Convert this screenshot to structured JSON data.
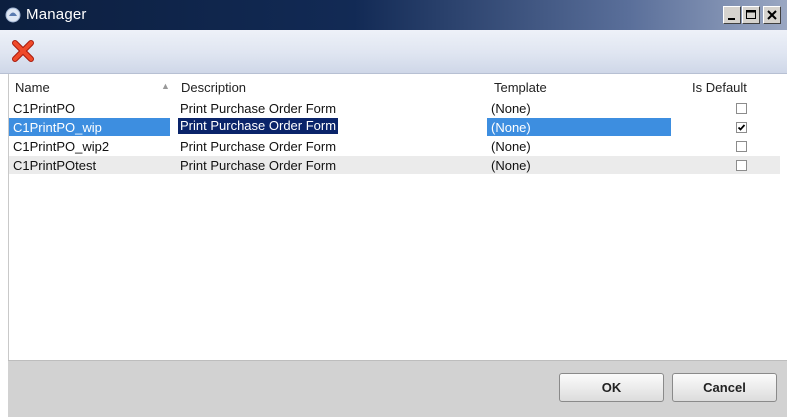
{
  "window": {
    "title": "Manager",
    "icon": "app-icon",
    "controls": [
      "minimize-icon",
      "maximize-icon",
      "close-icon"
    ]
  },
  "toolbar": {
    "delete_icon": "delete-x-icon",
    "delete_color": "#e8331c"
  },
  "grid": {
    "columns": [
      {
        "label": "Name",
        "sorted": "ascending"
      },
      {
        "label": "Description"
      },
      {
        "label": "Template"
      },
      {
        "label": "Is Default"
      }
    ],
    "rows": [
      {
        "name": "C1PrintPO",
        "description": "Print Purchase Order Form",
        "template": "(None)",
        "is_default": false,
        "selected": false
      },
      {
        "name": "C1PrintPO_wip",
        "description": "Print Purchase Order Form",
        "template": "(None)",
        "is_default": true,
        "selected": true
      },
      {
        "name": "C1PrintPO_wip2",
        "description": "Print Purchase Order Form",
        "template": "(None)",
        "is_default": false,
        "selected": false
      },
      {
        "name": "C1PrintPOtest",
        "description": "Print Purchase Order Form",
        "template": "(None)",
        "is_default": false,
        "selected": false
      }
    ],
    "selection_color": "#3d8ee0",
    "focus_color": "#0a246a"
  },
  "footer": {
    "ok_label": "OK",
    "cancel_label": "Cancel"
  }
}
